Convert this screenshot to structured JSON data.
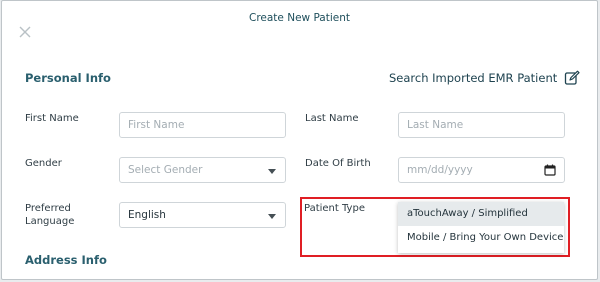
{
  "modal": {
    "title": "Create New Patient"
  },
  "personal_info": {
    "heading": "Personal Info",
    "search_emr_label": "Search Imported EMR Patient",
    "first_name": {
      "label": "First Name",
      "placeholder": "First Name",
      "value": ""
    },
    "last_name": {
      "label": "Last Name",
      "placeholder": "Last Name",
      "value": ""
    },
    "gender": {
      "label": "Gender",
      "placeholder": "Select Gender"
    },
    "dob": {
      "label": "Date Of Birth",
      "placeholder": "mm/dd/yyyy"
    },
    "language": {
      "label_line1": "Preferred",
      "label_line2": "Language",
      "value": "English"
    },
    "patient_type": {
      "label": "Patient Type",
      "options": [
        "aTouchAway / Simplified",
        "Mobile / Bring Your Own Device"
      ],
      "highlighted_index": 0
    }
  },
  "address_info": {
    "heading": "Address Info"
  },
  "colors": {
    "accent": "#2a5f6e",
    "highlight_box": "#e01e24"
  }
}
